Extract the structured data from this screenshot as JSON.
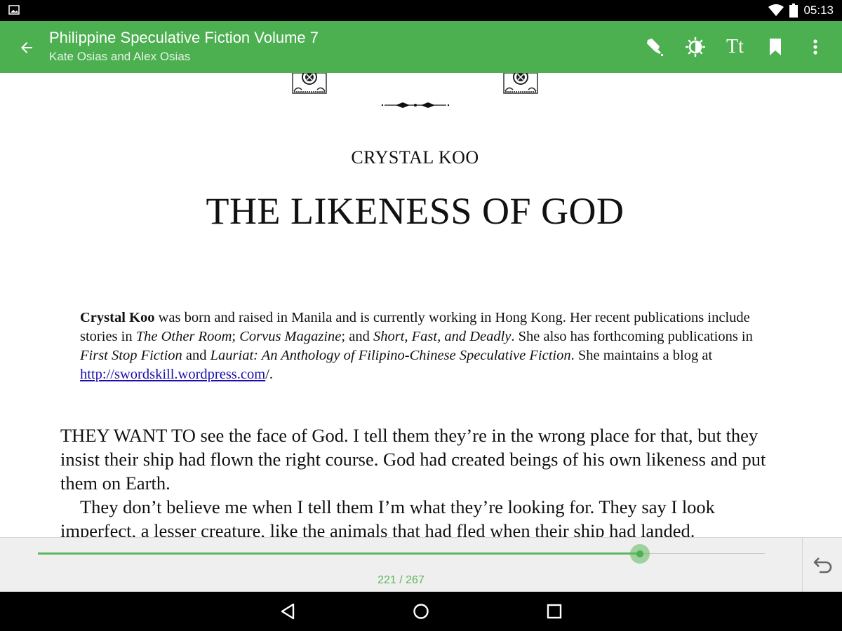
{
  "status_bar": {
    "time": "05:13",
    "icons": [
      "image-notification-icon",
      "wifi-icon",
      "battery-icon"
    ]
  },
  "toolbar": {
    "title": "Philippine Speculative Fiction Volume 7",
    "subtitle": "Kate Osias and Alex Osias",
    "actions": [
      "highlight-pen-icon",
      "brightness-icon",
      "font-size-icon",
      "bookmark-icon",
      "more-options-icon"
    ],
    "font_button_label": "Tt",
    "color": "#4caf50"
  },
  "page": {
    "author": "CRYSTAL KOO",
    "story_title": "THE LIKENESS OF GOD",
    "bio": {
      "name": "Crystal Koo",
      "t1": " was born and raised in Manila and is currently working in Hong Kong. Her recent publications include stories in ",
      "i1": "The Other Room",
      "t2": "; ",
      "i2": "Corvus Magazine",
      "t3": "; and ",
      "i3": "Short, Fast, and Deadly",
      "t4": ". She also has forthcoming publications in ",
      "i4": "First Stop Fiction",
      "t5": " and ",
      "i5": "Lauriat: An Anthology of Filipino-Chinese Speculative Fiction",
      "t6": ". She maintains a blog at ",
      "link": "http://swordskill.wordpress.com",
      "t7": "/."
    },
    "paragraphs": [
      "THEY WANT TO see the face of God. I tell them they’re in the wrong place for that, but they insist their ship had flown the right course. God had created beings of his own likeness and put them on Earth.",
      "They don’t believe me when I tell them I’m what they’re looking for. They say I look imperfect, a lesser creature, like the animals that had fled when their ship had landed."
    ]
  },
  "progress": {
    "current_page": 221,
    "total_pages": 267,
    "label": "221 / 267",
    "fraction": 0.828
  },
  "nav": {
    "buttons": [
      "back-triangle-icon",
      "home-circle-icon",
      "recents-square-icon"
    ]
  }
}
